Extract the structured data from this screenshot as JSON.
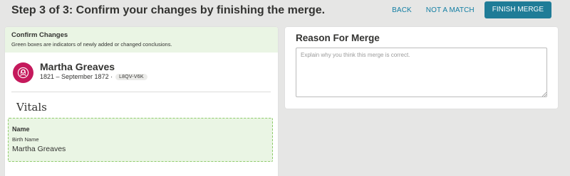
{
  "header": {
    "title": "Step 3 of 3: Confirm your changes by finishing the merge.",
    "back_label": "BACK",
    "not_match_label": "NOT A MATCH",
    "finish_label": "FINISH MERGE"
  },
  "confirm": {
    "title": "Confirm Changes",
    "note": "Green boxes are indicators of newly added or changed conclusions."
  },
  "person": {
    "name": "Martha Greaves",
    "lifespan": "1821 – September 1872 ·",
    "pid": "L8QV-V6K",
    "avatar_icon": "female-person-icon",
    "avatar_color": "#c5195c"
  },
  "vitals": {
    "heading": "Vitals",
    "name_label": "Name",
    "birth_name_label": "Birth Name",
    "birth_name_value": "Martha Greaves"
  },
  "reason": {
    "title": "Reason For Merge",
    "placeholder": "Explain why you think this merge is correct.",
    "value": ""
  },
  "colors": {
    "accent": "#1f7c97",
    "link": "#127ea3",
    "changed_bg": "#eaf5e4",
    "changed_border": "#8fcc6b"
  }
}
